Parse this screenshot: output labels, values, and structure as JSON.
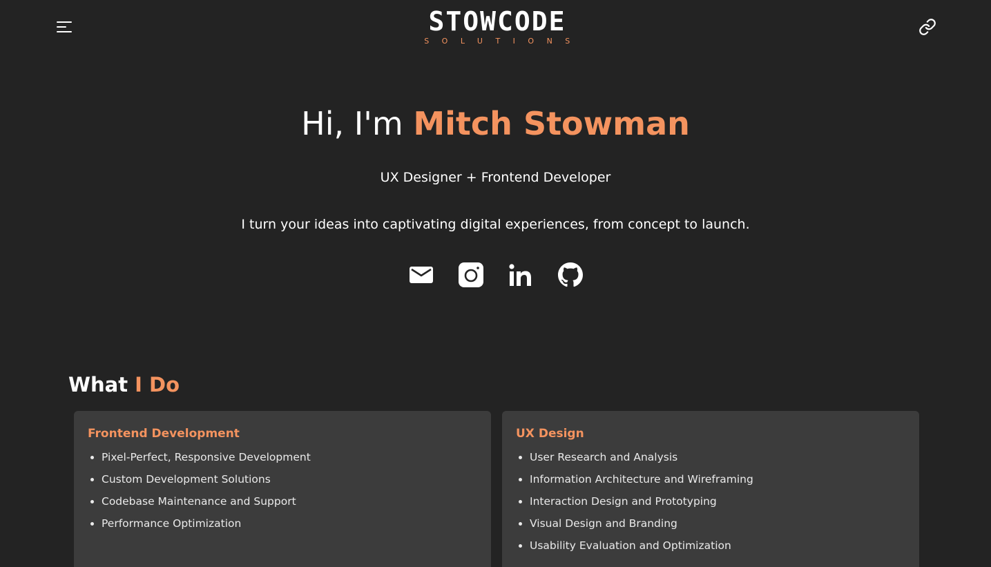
{
  "header": {
    "logo_main": "STOWCODE",
    "logo_sub": "SOLUTIONS",
    "menu_icon": "hamburger-menu-icon",
    "link_icon": "link-icon"
  },
  "hero": {
    "greeting": "Hi, I'm ",
    "name": "Mitch Stowman",
    "subtitle": "UX Designer + Frontend Developer",
    "description": "I turn your ideas into captivating digital experiences, from concept to launch."
  },
  "socials": [
    "email-icon",
    "instagram-icon",
    "linkedin-icon",
    "github-icon"
  ],
  "what_i_do": {
    "title_plain": "What ",
    "title_accent": "I Do",
    "cards": [
      {
        "title": "Frontend Development",
        "items": [
          "Pixel-Perfect, Responsive Development",
          "Custom Development Solutions",
          "Codebase Maintenance and Support",
          "Performance Optimization"
        ]
      },
      {
        "title": "UX Design",
        "items": [
          "User Research and Analysis",
          "Information Architecture and Wireframing",
          "Interaction Design and Prototyping",
          "Visual Design and Branding",
          "Usability Evaluation and Optimization"
        ]
      }
    ]
  },
  "colors": {
    "background": "#232323",
    "card": "#3c3c3c",
    "accent": "#f4935f",
    "text": "#ffffff"
  }
}
